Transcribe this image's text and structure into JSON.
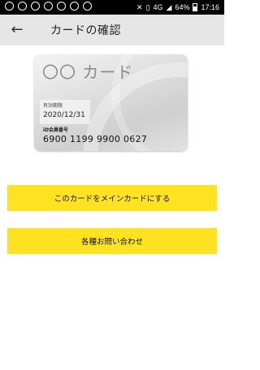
{
  "status_bar": {
    "left_icons": [
      "line-icon",
      "wifi-icon",
      "notification-icon",
      "mail-icon",
      "mail-icon",
      "photo-icon",
      "location-icon"
    ],
    "signal": "4G",
    "battery": "64%",
    "time": "17:16"
  },
  "header": {
    "title": "カードの確認",
    "back_icon": "arrow-left-icon"
  },
  "card": {
    "name": "〇〇 カード",
    "expiry_label": "有効期限",
    "expiry_value": "2020/12/31",
    "member_id_label": "iD会員番号",
    "member_id_value": "6900 1199 9900 0627"
  },
  "actions": {
    "set_main_label": "このカードをメインカードにする",
    "inquiry_label": "各種お問い合わせ"
  },
  "colors": {
    "accent_yellow": "#ffe320",
    "appbar_bg": "#e6e6e6"
  }
}
